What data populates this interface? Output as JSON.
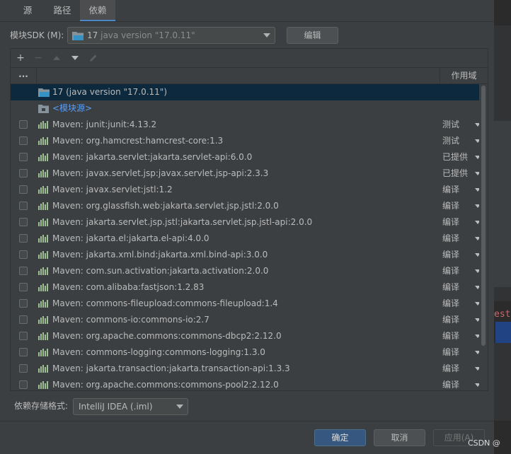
{
  "tabs": [
    {
      "label": "源"
    },
    {
      "label": "路径"
    },
    {
      "label": "依赖"
    }
  ],
  "sdk": {
    "label": "模块SDK (M):",
    "value_name": "17",
    "value_detail": "java version \"17.0.11\"",
    "edit_button": "编辑"
  },
  "toolbar": {
    "add": "+",
    "remove": "−",
    "edit_icon": "pencil-icon"
  },
  "table": {
    "header_dots": "...",
    "header_scope": "作用域",
    "sdk_row": "17 (java version \"17.0.11\")",
    "source_row": "<模块源>",
    "rows": [
      {
        "name": "Maven: junit:junit:4.13.2",
        "scope": "测试"
      },
      {
        "name": "Maven: org.hamcrest:hamcrest-core:1.3",
        "scope": "测试"
      },
      {
        "name": "Maven: jakarta.servlet:jakarta.servlet-api:6.0.0",
        "scope": "已提供"
      },
      {
        "name": "Maven: javax.servlet.jsp:javax.servlet.jsp-api:2.3.3",
        "scope": "已提供"
      },
      {
        "name": "Maven: javax.servlet:jstl:1.2",
        "scope": "编译"
      },
      {
        "name": "Maven: org.glassfish.web:jakarta.servlet.jsp.jstl:2.0.0",
        "scope": "编译"
      },
      {
        "name": "Maven: jakarta.servlet.jsp.jstl:jakarta.servlet.jsp.jstl-api:2.0.0",
        "scope": "编译"
      },
      {
        "name": "Maven: jakarta.el:jakarta.el-api:4.0.0",
        "scope": "编译"
      },
      {
        "name": "Maven: jakarta.xml.bind:jakarta.xml.bind-api:3.0.0",
        "scope": "编译"
      },
      {
        "name": "Maven: com.sun.activation:jakarta.activation:2.0.0",
        "scope": "编译"
      },
      {
        "name": "Maven: com.alibaba:fastjson:1.2.83",
        "scope": "编译"
      },
      {
        "name": "Maven: commons-fileupload:commons-fileupload:1.4",
        "scope": "编译"
      },
      {
        "name": "Maven: commons-io:commons-io:2.7",
        "scope": "编译"
      },
      {
        "name": "Maven: org.apache.commons:commons-dbcp2:2.12.0",
        "scope": "编译"
      },
      {
        "name": "Maven: commons-logging:commons-logging:1.3.0",
        "scope": "编译"
      },
      {
        "name": "Maven: jakarta.transaction:jakarta.transaction-api:1.3.3",
        "scope": "编译"
      },
      {
        "name": "Maven: org.apache.commons:commons-pool2:2.12.0",
        "scope": "编译"
      }
    ]
  },
  "storage": {
    "label": "依赖存储格式:",
    "value": "IntelliJ IDEA (.iml)"
  },
  "footer": {
    "ok": "确定",
    "cancel": "取消",
    "apply": "应用(A)"
  },
  "background_text": "est",
  "watermark": "CSDN @",
  "colors": {
    "accent": "#4a88c7",
    "selection": "#0d293e",
    "primary_button": "#365880",
    "link": "#589df6"
  }
}
